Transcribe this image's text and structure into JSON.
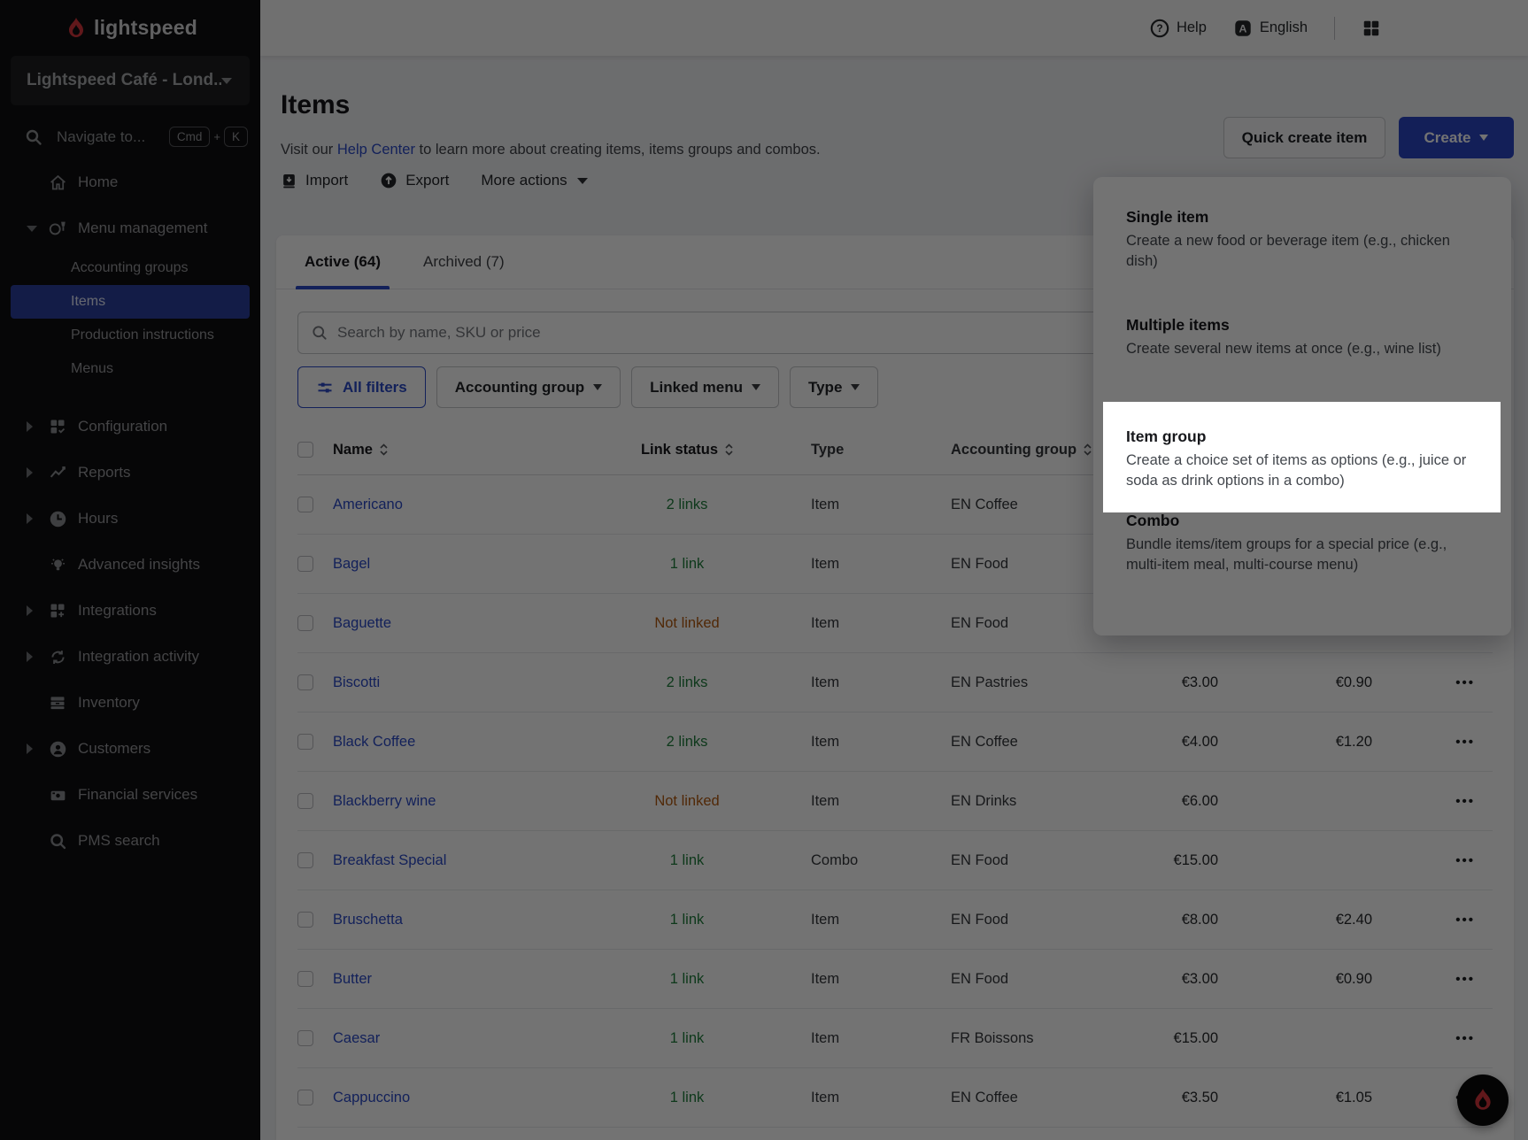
{
  "brand": {
    "logo_text": "lightspeed",
    "flame_color": "#d8373c"
  },
  "sidebar": {
    "store": "Lightspeed Café - Lond...",
    "navigate_placeholder": "Navigate to...",
    "kbd1": "Cmd",
    "kbd_plus": "+",
    "kbd2": "K",
    "nav": [
      {
        "label": "Home"
      },
      {
        "label": "Menu management"
      },
      {
        "label": "Configuration"
      },
      {
        "label": "Reports"
      },
      {
        "label": "Hours"
      },
      {
        "label": "Advanced insights"
      },
      {
        "label": "Integrations"
      },
      {
        "label": "Integration activity"
      },
      {
        "label": "Inventory"
      },
      {
        "label": "Customers"
      },
      {
        "label": "Financial services"
      },
      {
        "label": "PMS search"
      }
    ],
    "menu_children": [
      {
        "label": "Accounting groups"
      },
      {
        "label": "Items"
      },
      {
        "label": "Production instructions"
      },
      {
        "label": "Menus"
      }
    ],
    "selected_child": "Items"
  },
  "topbar": {
    "help": "Help",
    "language": "English"
  },
  "page": {
    "title": "Items",
    "subtitle_pre": "Visit our ",
    "subtitle_link": "Help Center",
    "subtitle_post": " to learn more about creating items, items groups and combos.",
    "import_label": "Import",
    "export_label": "Export",
    "more_actions_label": "More actions",
    "quick_create_label": "Quick create item",
    "create_label": "Create"
  },
  "tabs": [
    {
      "label": "Active (64)",
      "active": true
    },
    {
      "label": "Archived (7)",
      "active": false
    }
  ],
  "search": {
    "placeholder": "Search by name, SKU or price"
  },
  "filters": [
    {
      "label": "All filters"
    },
    {
      "label": "Accounting group"
    },
    {
      "label": "Linked menu"
    },
    {
      "label": "Type"
    }
  ],
  "table": {
    "headers": {
      "name": "Name",
      "link_status": "Link status",
      "type": "Type",
      "accounting_group": "Accounting group"
    },
    "rows": [
      {
        "name": "Americano",
        "link_status": "2 links",
        "unlinked": false,
        "type": "Item",
        "group": "EN Coffee",
        "price": "",
        "tax": "",
        "kebab": "•••"
      },
      {
        "name": "Bagel",
        "link_status": "1 link",
        "unlinked": false,
        "type": "Item",
        "group": "EN Food",
        "price": "",
        "tax": "",
        "kebab": "•••"
      },
      {
        "name": "Baguette",
        "link_status": "Not linked",
        "unlinked": true,
        "type": "Item",
        "group": "EN Food",
        "price": "",
        "tax": "",
        "kebab": "•••"
      },
      {
        "name": "Biscotti",
        "link_status": "2 links",
        "unlinked": false,
        "type": "Item",
        "group": "EN Pastries",
        "price": "€3.00",
        "tax": "€0.90",
        "kebab": "•••"
      },
      {
        "name": "Black Coffee",
        "link_status": "2 links",
        "unlinked": false,
        "type": "Item",
        "group": "EN Coffee",
        "price": "€4.00",
        "tax": "€1.20",
        "kebab": "•••"
      },
      {
        "name": "Blackberry wine",
        "link_status": "Not linked",
        "unlinked": true,
        "type": "Item",
        "group": "EN Drinks",
        "price": "€6.00",
        "tax": "",
        "kebab": "•••"
      },
      {
        "name": "Breakfast Special",
        "link_status": "1 link",
        "unlinked": false,
        "type": "Combo",
        "group": "EN Food",
        "price": "€15.00",
        "tax": "",
        "kebab": "•••"
      },
      {
        "name": "Bruschetta",
        "link_status": "1 link",
        "unlinked": false,
        "type": "Item",
        "group": "EN Food",
        "price": "€8.00",
        "tax": "€2.40",
        "kebab": "•••"
      },
      {
        "name": "Butter",
        "link_status": "1 link",
        "unlinked": false,
        "type": "Item",
        "group": "EN Food",
        "price": "€3.00",
        "tax": "€0.90",
        "kebab": "•••"
      },
      {
        "name": "Caesar",
        "link_status": "1 link",
        "unlinked": false,
        "type": "Item",
        "group": "FR Boissons",
        "price": "€15.00",
        "tax": "",
        "kebab": "•••"
      },
      {
        "name": "Cappuccino",
        "link_status": "1 link",
        "unlinked": false,
        "type": "Item",
        "group": "EN Coffee",
        "price": "€3.50",
        "tax": "€1.05",
        "kebab": "•••"
      }
    ]
  },
  "create_menu": {
    "items": [
      {
        "title": "Single item",
        "desc": "Create a new food or beverage item (e.g., chicken dish)"
      },
      {
        "title": "Multiple items",
        "desc": "Create several new items at once (e.g., wine list)"
      },
      {
        "title": "Item group",
        "desc": "Create a choice set of items as options (e.g., juice or soda as drink options in a combo)"
      },
      {
        "title": "Combo",
        "desc": "Bundle items/item groups for a special price (e.g., multi-item meal, multi-course menu)"
      }
    ],
    "highlighted": "Item group"
  },
  "colors": {
    "primary_blue": "#2b4ac7",
    "create_button": "#2b46c4",
    "sidebar_bg": "#0e0e10",
    "sidebar_selected": "#2b3f9e",
    "linked_green": "#1f7e3d",
    "not_linked_orange": "#b35a0f",
    "flame_red": "#d8373c",
    "overlay": "rgba(0,0,0,0.55)"
  }
}
